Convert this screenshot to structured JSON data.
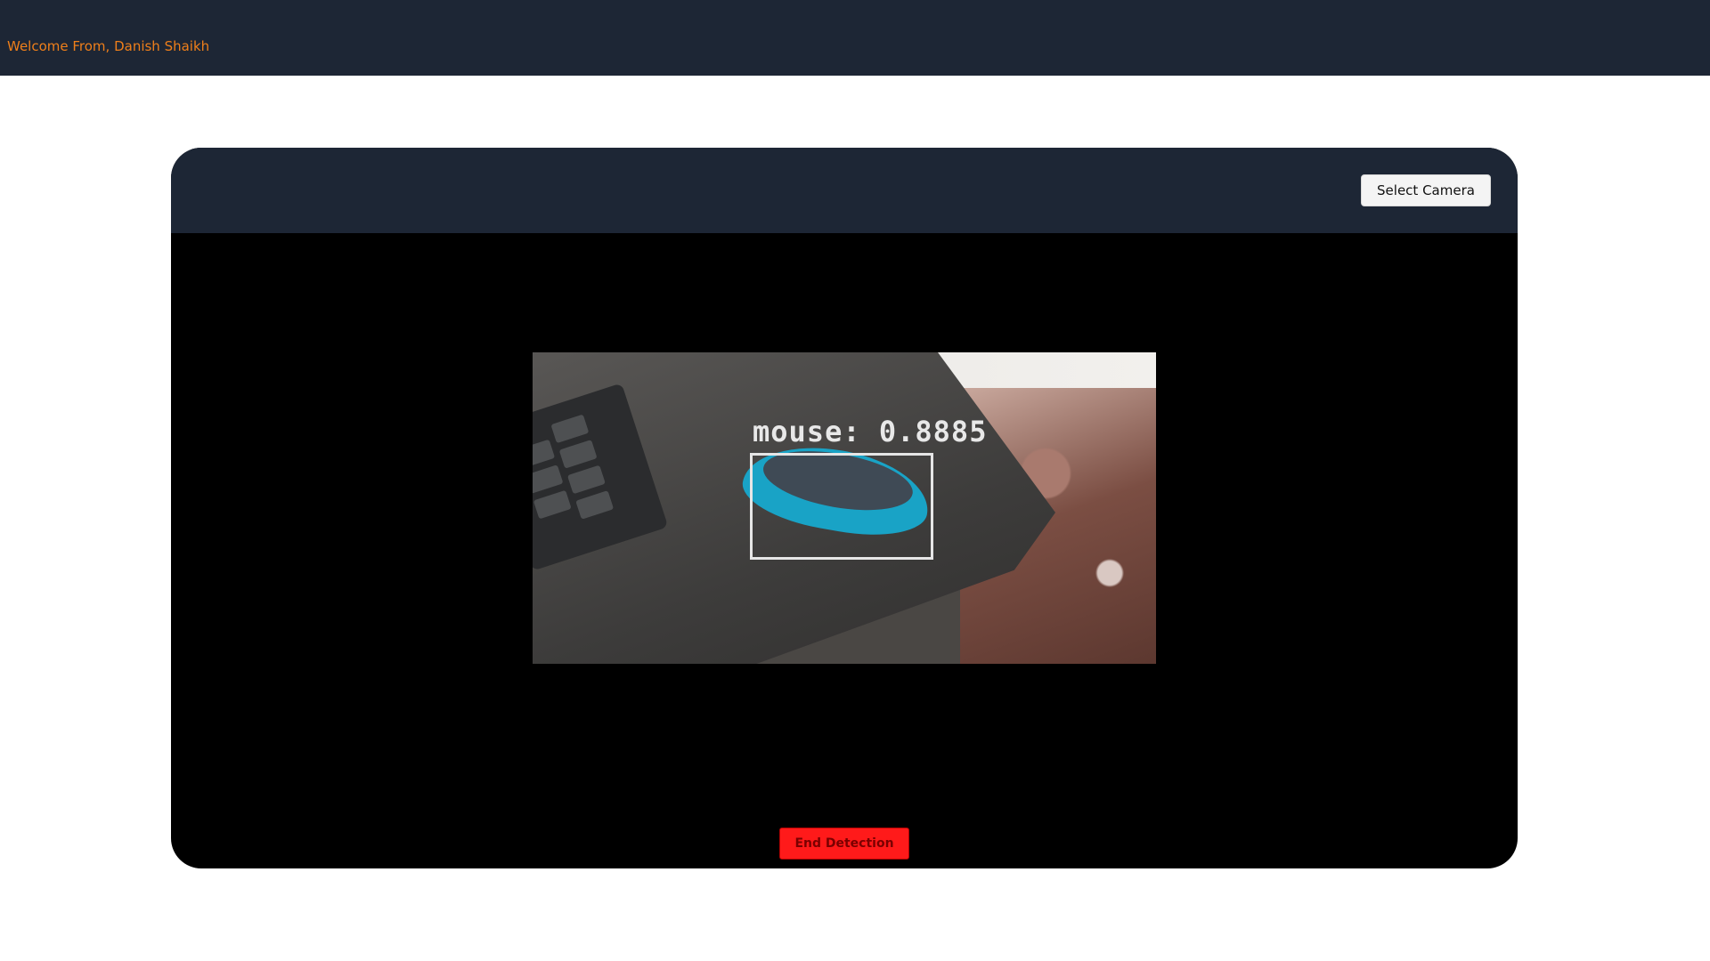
{
  "header": {
    "welcome_text": "Welcome From, Danish Shaikh"
  },
  "panel": {
    "select_camera_label": "Select Camera",
    "end_detection_label": "End Detection"
  },
  "detection": {
    "label": "mouse: 0.8885",
    "class": "mouse",
    "confidence": 0.8885
  },
  "colors": {
    "topbar": "#1d2635",
    "welcome_text": "#ef7f1a",
    "end_button": "#ff1a1a",
    "panel_bg": "#000000"
  }
}
